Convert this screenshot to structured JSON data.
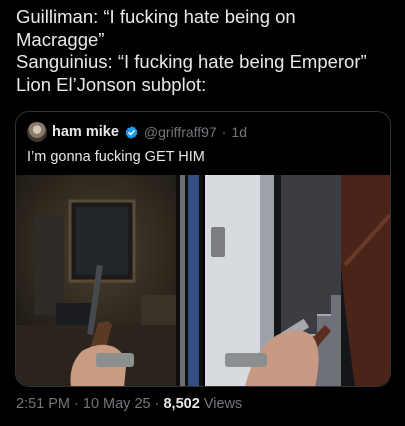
{
  "post": {
    "lines": [
      "Guilliman: “I fucking hate being on",
      "Macragge”",
      "Sanguinius: “I fucking hate being Emperor”",
      "Lion El’Jonson subplot:"
    ]
  },
  "quoted_post": {
    "display_name": "ham mike",
    "handle": "@griffraff97",
    "separator": "·",
    "time": "1d",
    "text": "I’m gonna fucking GET HIM",
    "verified_color": "#1d9bf0"
  },
  "meta": {
    "timestamp": "2:51 PM · 10 May 25 ·",
    "views_count": "8,502",
    "views_label": "Views"
  },
  "colors": {
    "background": "#000000",
    "text": "#e7e9ea",
    "muted": "#71767b",
    "border": "#2f3336"
  }
}
